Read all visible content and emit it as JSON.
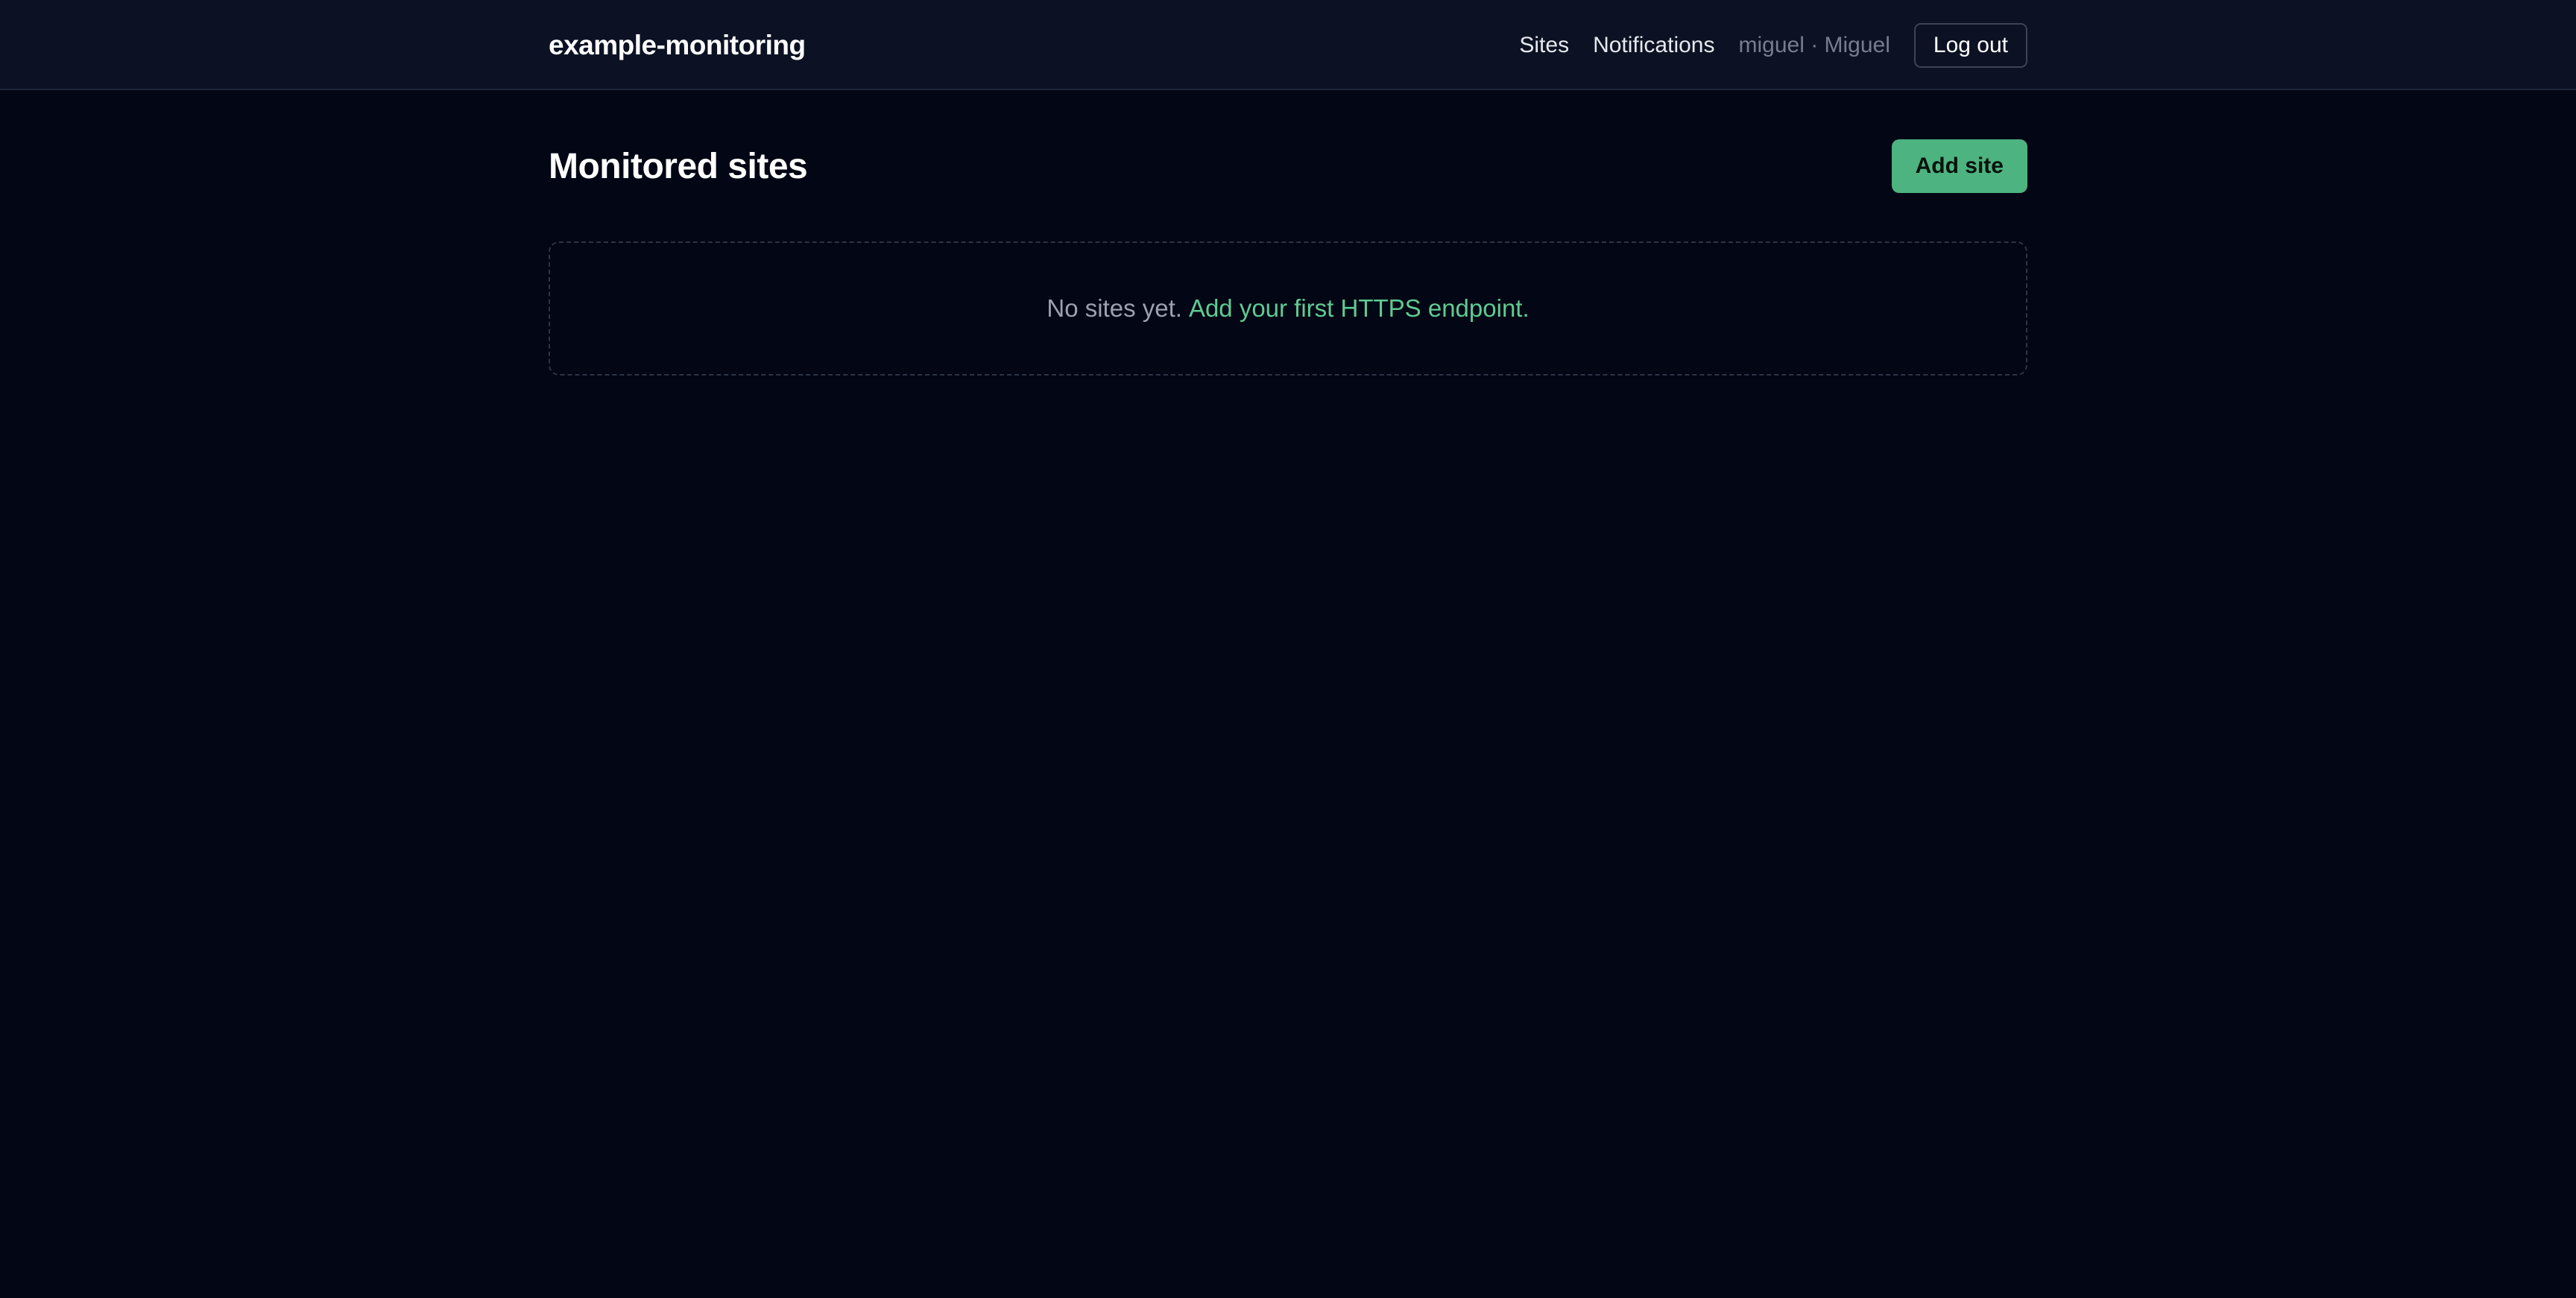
{
  "header": {
    "brand": "example-monitoring",
    "nav": {
      "sites": "Sites",
      "notifications": "Notifications"
    },
    "user": "miguel · Miguel",
    "logout_label": "Log out"
  },
  "main": {
    "title": "Monitored sites",
    "add_label": "Add site",
    "empty": {
      "text": "No sites yet.",
      "link": "Add your first HTTPS endpoint."
    }
  },
  "colors": {
    "background": "#030614",
    "header_background": "#0c1223",
    "accent": "#4db380",
    "link": "#5fcb93"
  }
}
